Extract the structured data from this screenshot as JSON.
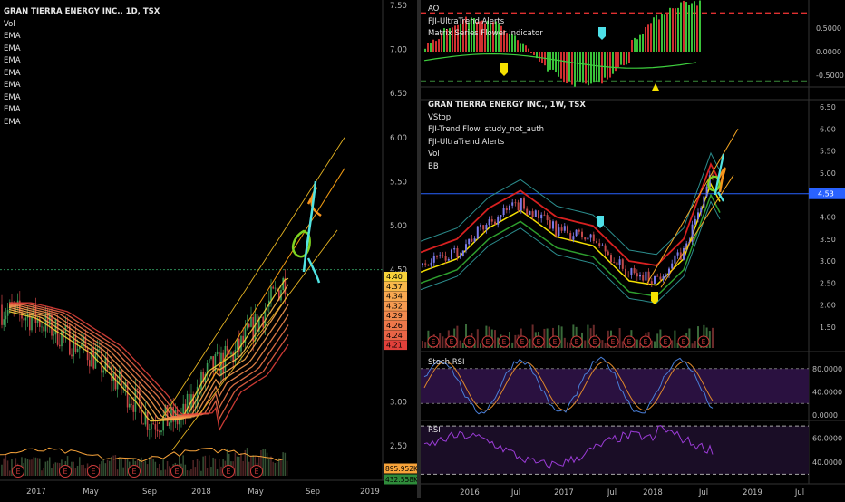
{
  "left_chart": {
    "title": "GRAN TIERRA ENERGY INC., 1D, TSX",
    "indicators": [
      "Vol",
      "EMA",
      "EMA",
      "EMA",
      "EMA",
      "EMA",
      "EMA",
      "EMA",
      "EMA"
    ],
    "y_ticks": [
      "7.50",
      "7.00",
      "6.50",
      "6.00",
      "5.50",
      "5.00",
      "4.50",
      "3.00",
      "2.50"
    ],
    "price_tags": [
      {
        "label": "4.40",
        "color": "#f7d23a"
      },
      {
        "label": "4.37",
        "color": "#f8b84a"
      },
      {
        "label": "4.34",
        "color": "#f8a850"
      },
      {
        "label": "4.32",
        "color": "#f59a50"
      },
      {
        "label": "4.29",
        "color": "#f28a4e"
      },
      {
        "label": "4.26",
        "color": "#ee784a"
      },
      {
        "label": "4.24",
        "color": "#e96446"
      },
      {
        "label": "4.21",
        "color": "#e0403a"
      }
    ],
    "volume_tags": [
      {
        "label": "895.952K",
        "color": "#f7a33a"
      },
      {
        "label": "432.558K",
        "color": "#2e8b3a"
      }
    ],
    "x_ticks": [
      "2017",
      "May",
      "Sep",
      "2018",
      "May",
      "Sep",
      "2019"
    ],
    "earnings_marker": "E",
    "horizontal_level": 4.5
  },
  "right_top": {
    "indicators": [
      "AO",
      "FJI-UltraTrend Alerts",
      "Matrix Series Flower Indicator"
    ],
    "y_ticks": [
      "0.5000",
      "0.0000",
      "-0.5000"
    ]
  },
  "right_main": {
    "title": "GRAN TIERRA ENERGY INC., 1W, TSX",
    "indicators": [
      "VStop",
      "FJI-Trend Flow: study_not_auth",
      "FJI-UltraTrend Alerts",
      "Vol",
      "BB"
    ],
    "y_ticks": [
      "6.50",
      "6.00",
      "5.50",
      "5.00",
      "4.00",
      "3.50",
      "3.00",
      "2.50",
      "2.00",
      "1.50"
    ],
    "price_tag": {
      "label": "4.53",
      "color": "#2962ff"
    },
    "earnings_marker": "E"
  },
  "right_stoch": {
    "label": "Stoch RSI",
    "y_ticks": [
      "80.0000",
      "40.0000",
      "0.0000"
    ]
  },
  "right_rsi": {
    "label": "RSI",
    "y_ticks": [
      "60.0000",
      "40.0000"
    ]
  },
  "right_x_ticks": [
    "2016",
    "Jul",
    "2017",
    "Jul",
    "2018",
    "Jul",
    "2019",
    "Jul"
  ],
  "chart_data": [
    {
      "type": "line",
      "title": "GRAN TIERRA ENERGY INC., 1D, TSX",
      "x": [
        "2017-01",
        "2017-03",
        "2017-05",
        "2017-07",
        "2017-09",
        "2017-11",
        "2018-01",
        "2018-03",
        "2018-05",
        "2018-07",
        "2018-08"
      ],
      "series": [
        {
          "name": "EMA",
          "values": [
            4.1,
            3.8,
            3.55,
            3.15,
            2.75,
            2.8,
            3.3,
            3.5,
            4.0,
            4.4,
            4.4
          ]
        }
      ],
      "ylim": [
        2.2,
        7.6
      ]
    },
    {
      "type": "line",
      "title": "GRAN TIERRA ENERGY INC., 1W, TSX",
      "x": [
        "2015-11",
        "2016-03",
        "2016-07",
        "2016-11",
        "2017-03",
        "2017-07",
        "2017-11",
        "2018-03",
        "2018-07",
        "2018-08"
      ],
      "series": [
        {
          "values": [
            2.9,
            3.6,
            4.2,
            3.8,
            3.6,
            2.9,
            2.6,
            3.4,
            4.9,
            4.5
          ]
        }
      ],
      "ylim": [
        1.2,
        6.7
      ]
    }
  ]
}
